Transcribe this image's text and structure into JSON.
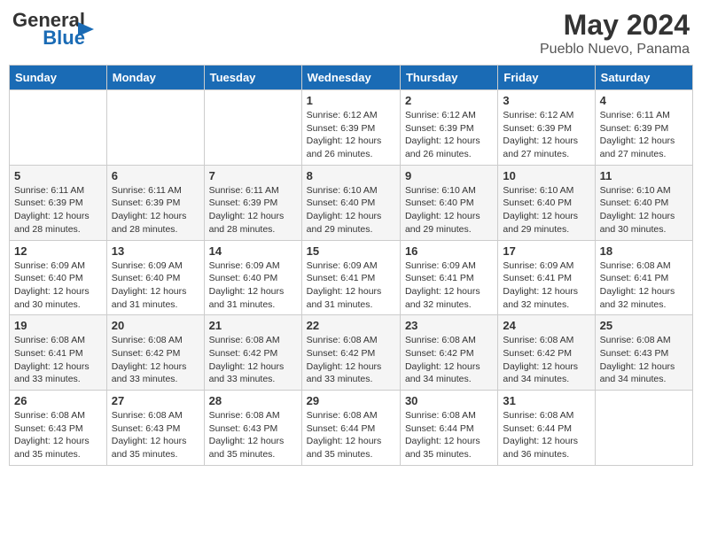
{
  "logo": {
    "line1": "General",
    "line2": "Blue"
  },
  "title": "May 2024",
  "subtitle": "Pueblo Nuevo, Panama",
  "days_of_week": [
    "Sunday",
    "Monday",
    "Tuesday",
    "Wednesday",
    "Thursday",
    "Friday",
    "Saturday"
  ],
  "weeks": [
    [
      {
        "day": "",
        "info": ""
      },
      {
        "day": "",
        "info": ""
      },
      {
        "day": "",
        "info": ""
      },
      {
        "day": "1",
        "info": "Sunrise: 6:12 AM\nSunset: 6:39 PM\nDaylight: 12 hours\nand 26 minutes."
      },
      {
        "day": "2",
        "info": "Sunrise: 6:12 AM\nSunset: 6:39 PM\nDaylight: 12 hours\nand 26 minutes."
      },
      {
        "day": "3",
        "info": "Sunrise: 6:12 AM\nSunset: 6:39 PM\nDaylight: 12 hours\nand 27 minutes."
      },
      {
        "day": "4",
        "info": "Sunrise: 6:11 AM\nSunset: 6:39 PM\nDaylight: 12 hours\nand 27 minutes."
      }
    ],
    [
      {
        "day": "5",
        "info": "Sunrise: 6:11 AM\nSunset: 6:39 PM\nDaylight: 12 hours\nand 28 minutes."
      },
      {
        "day": "6",
        "info": "Sunrise: 6:11 AM\nSunset: 6:39 PM\nDaylight: 12 hours\nand 28 minutes."
      },
      {
        "day": "7",
        "info": "Sunrise: 6:11 AM\nSunset: 6:39 PM\nDaylight: 12 hours\nand 28 minutes."
      },
      {
        "day": "8",
        "info": "Sunrise: 6:10 AM\nSunset: 6:40 PM\nDaylight: 12 hours\nand 29 minutes."
      },
      {
        "day": "9",
        "info": "Sunrise: 6:10 AM\nSunset: 6:40 PM\nDaylight: 12 hours\nand 29 minutes."
      },
      {
        "day": "10",
        "info": "Sunrise: 6:10 AM\nSunset: 6:40 PM\nDaylight: 12 hours\nand 29 minutes."
      },
      {
        "day": "11",
        "info": "Sunrise: 6:10 AM\nSunset: 6:40 PM\nDaylight: 12 hours\nand 30 minutes."
      }
    ],
    [
      {
        "day": "12",
        "info": "Sunrise: 6:09 AM\nSunset: 6:40 PM\nDaylight: 12 hours\nand 30 minutes."
      },
      {
        "day": "13",
        "info": "Sunrise: 6:09 AM\nSunset: 6:40 PM\nDaylight: 12 hours\nand 31 minutes."
      },
      {
        "day": "14",
        "info": "Sunrise: 6:09 AM\nSunset: 6:40 PM\nDaylight: 12 hours\nand 31 minutes."
      },
      {
        "day": "15",
        "info": "Sunrise: 6:09 AM\nSunset: 6:41 PM\nDaylight: 12 hours\nand 31 minutes."
      },
      {
        "day": "16",
        "info": "Sunrise: 6:09 AM\nSunset: 6:41 PM\nDaylight: 12 hours\nand 32 minutes."
      },
      {
        "day": "17",
        "info": "Sunrise: 6:09 AM\nSunset: 6:41 PM\nDaylight: 12 hours\nand 32 minutes."
      },
      {
        "day": "18",
        "info": "Sunrise: 6:08 AM\nSunset: 6:41 PM\nDaylight: 12 hours\nand 32 minutes."
      }
    ],
    [
      {
        "day": "19",
        "info": "Sunrise: 6:08 AM\nSunset: 6:41 PM\nDaylight: 12 hours\nand 33 minutes."
      },
      {
        "day": "20",
        "info": "Sunrise: 6:08 AM\nSunset: 6:42 PM\nDaylight: 12 hours\nand 33 minutes."
      },
      {
        "day": "21",
        "info": "Sunrise: 6:08 AM\nSunset: 6:42 PM\nDaylight: 12 hours\nand 33 minutes."
      },
      {
        "day": "22",
        "info": "Sunrise: 6:08 AM\nSunset: 6:42 PM\nDaylight: 12 hours\nand 33 minutes."
      },
      {
        "day": "23",
        "info": "Sunrise: 6:08 AM\nSunset: 6:42 PM\nDaylight: 12 hours\nand 34 minutes."
      },
      {
        "day": "24",
        "info": "Sunrise: 6:08 AM\nSunset: 6:42 PM\nDaylight: 12 hours\nand 34 minutes."
      },
      {
        "day": "25",
        "info": "Sunrise: 6:08 AM\nSunset: 6:43 PM\nDaylight: 12 hours\nand 34 minutes."
      }
    ],
    [
      {
        "day": "26",
        "info": "Sunrise: 6:08 AM\nSunset: 6:43 PM\nDaylight: 12 hours\nand 35 minutes."
      },
      {
        "day": "27",
        "info": "Sunrise: 6:08 AM\nSunset: 6:43 PM\nDaylight: 12 hours\nand 35 minutes."
      },
      {
        "day": "28",
        "info": "Sunrise: 6:08 AM\nSunset: 6:43 PM\nDaylight: 12 hours\nand 35 minutes."
      },
      {
        "day": "29",
        "info": "Sunrise: 6:08 AM\nSunset: 6:44 PM\nDaylight: 12 hours\nand 35 minutes."
      },
      {
        "day": "30",
        "info": "Sunrise: 6:08 AM\nSunset: 6:44 PM\nDaylight: 12 hours\nand 35 minutes."
      },
      {
        "day": "31",
        "info": "Sunrise: 6:08 AM\nSunset: 6:44 PM\nDaylight: 12 hours\nand 36 minutes."
      },
      {
        "day": "",
        "info": ""
      }
    ]
  ]
}
